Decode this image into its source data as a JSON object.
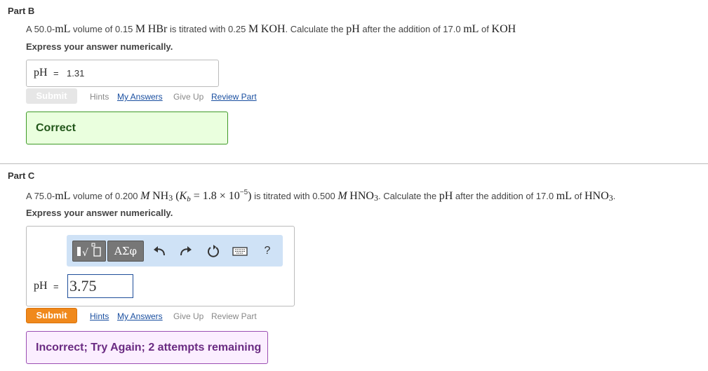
{
  "part_b": {
    "title": "Part B",
    "q": {
      "t1": "A 50.0-",
      "mL": "mL",
      "t2": " volume of 0.15 ",
      "M": "M",
      "HBr": "HBr",
      "t3": " is titrated with 0.25 ",
      "KOH": "KOH",
      "t4": ". Calculate the ",
      "pH": "pH",
      "t5": " after the addition of 17.0 ",
      "t6": " of "
    },
    "instruction": "Express your answer numerically.",
    "answer_label": "pH",
    "eq": "=",
    "answer_value": "1.31",
    "submit": "Submit",
    "hints": "Hints",
    "my_answers": "My Answers",
    "give_up": "Give Up",
    "review_part": "Review Part",
    "feedback": "Correct"
  },
  "part_c": {
    "title": "Part C",
    "q": {
      "t1": "A 75.0-",
      "mL": "mL",
      "t2": " volume of 0.200 ",
      "M": "M",
      "NH": "NH",
      "sub3": "3",
      "open": " (",
      "K": "K",
      "b": "b",
      "eqv": " = 1.8 × 10",
      "exp": "−5",
      "close": ")",
      "t3": " is titrated with 0.500 ",
      "HNO": "HNO",
      "t4": ". Calculate the ",
      "pH": "pH",
      "t5": " after the addition of 17.0 ",
      "t6": " of ",
      "end": "."
    },
    "instruction": "Express your answer numerically.",
    "toolbar": {
      "template_icon": "template-icon",
      "greek_label": "ΑΣφ",
      "undo_icon": "undo-icon",
      "redo_icon": "redo-icon",
      "reset_icon": "reset-icon",
      "keyboard_icon": "keyboard-icon",
      "help": "?"
    },
    "answer_label": "pH",
    "eq": "=",
    "answer_value": "3.75",
    "submit": "Submit",
    "hints": "Hints",
    "my_answers": "My Answers",
    "give_up": "Give Up",
    "review_part": "Review Part",
    "feedback": "Incorrect; Try Again; 2 attempts remaining"
  },
  "colors": {
    "submit_orange": "#f0891c",
    "correct_bg": "#eaffde",
    "incorrect_bg": "#fbeeff",
    "link_blue": "#1a4fa0"
  }
}
